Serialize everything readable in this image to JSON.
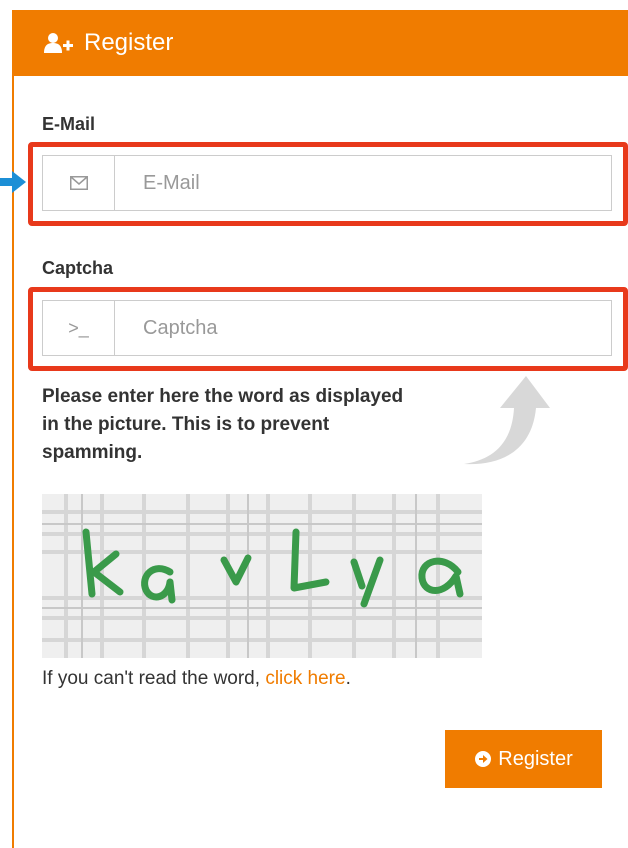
{
  "panel": {
    "title": "Register",
    "title_icon": "user-plus-icon",
    "accent_color": "#f07c00"
  },
  "email": {
    "label": "E-Mail",
    "placeholder": "E-Mail",
    "icon": "envelope-icon"
  },
  "captcha": {
    "label": "Captcha",
    "placeholder": "Captcha",
    "icon": "terminal-prompt-icon",
    "icon_glyph": ">_",
    "help_text": "Please enter here the word as displayed in the picture. This is to prevent spamming.",
    "image_word": "kavLya",
    "reload_prefix": "If you can't read the word, ",
    "reload_link": "click here",
    "reload_suffix": "."
  },
  "submit": {
    "label": "Register",
    "icon": "arrow-circle-right-icon"
  },
  "annotations": {
    "highlight_color": "#e8391b",
    "pointer_color": "#1c8fd6",
    "hint_arrow": "curved-up-arrow-icon"
  }
}
